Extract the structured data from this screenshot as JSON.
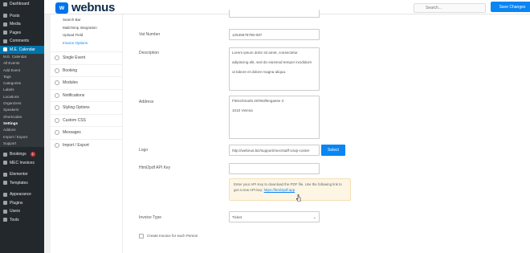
{
  "wp_menu": {
    "top": [
      {
        "label": "Dashboard",
        "icon": "dashboard-icon"
      }
    ],
    "main": [
      {
        "label": "Posts",
        "icon": "pin-icon"
      },
      {
        "label": "Media",
        "icon": "media-icon"
      },
      {
        "label": "Pages",
        "icon": "page-icon"
      },
      {
        "label": "Comments",
        "icon": "comment-icon"
      }
    ],
    "mec_label": "M.E. Calendar",
    "mec_sub": [
      "M.E. Calendar",
      "All Events",
      "Add Event",
      "Tags",
      "Categories",
      "Labels",
      "Locations",
      "Organizers",
      "Speakers",
      "Shortcodes",
      "Settings",
      "Addons",
      "Import / Export",
      "Support"
    ],
    "bottom": [
      {
        "label": "Bookings",
        "icon": "booking-icon",
        "badge": "1"
      },
      {
        "label": "MEC Invoices",
        "icon": "invoice-icon"
      },
      {
        "label": "Elementor",
        "icon": "elementor-icon"
      },
      {
        "label": "Templates",
        "icon": "template-icon"
      },
      {
        "label": "Appearance",
        "icon": "brush-icon"
      },
      {
        "label": "Plugins",
        "icon": "plugin-icon"
      },
      {
        "label": "Users",
        "icon": "user-icon"
      },
      {
        "label": "Tools",
        "icon": "tools-icon"
      }
    ]
  },
  "header": {
    "brand": "webnus",
    "search_placeholder": "Search...",
    "save_label": "Save Changes"
  },
  "settings_nav": {
    "subitems": [
      "Search Bar",
      "Mailchimp Integration",
      "Upload Field",
      "Invoice Options"
    ],
    "items": [
      {
        "label": "Single Event",
        "icon": "calendar-icon"
      },
      {
        "label": "Booking",
        "icon": "ticket-icon"
      },
      {
        "label": "Modules",
        "icon": "modules-icon"
      },
      {
        "label": "Notifications",
        "icon": "bell-icon"
      },
      {
        "label": "Styling Options",
        "icon": "palette-icon"
      },
      {
        "label": "Custom CSS",
        "icon": "css-icon"
      },
      {
        "label": "Messages",
        "icon": "message-icon"
      },
      {
        "label": "Import / Export",
        "icon": "import-export-icon"
      }
    ]
  },
  "form": {
    "vat_label": "Vat Number",
    "vat_value": "12545678790-087",
    "description_label": "Description",
    "description_lines": [
      "Lorem ipsum dolor sit amet, consectetur",
      "adipiscing elit, sed do eiusmod tempor incididunt",
      "ut labore et dolore magna aliqua."
    ],
    "address_label": "Address",
    "address_lines": [
      "Fleischmarkt 20/Wolfengasse 3",
      "1010 Vienna"
    ],
    "logo_label": "Logo",
    "logo_value": "http://webnus.biz/support/mec/staff-1/wp-conter",
    "select_label": "Select",
    "api_label": "Html2pdf API Key",
    "api_value": "",
    "notice_text": "Enter your API Key to download the PDF file. Use the following link to get a new API key:",
    "notice_link": "https://html2pdf.app",
    "invoice_type_label": "Invoice Type",
    "invoice_type_value": "Ticket",
    "checkbox_label": "Create Invoice for each Person"
  }
}
